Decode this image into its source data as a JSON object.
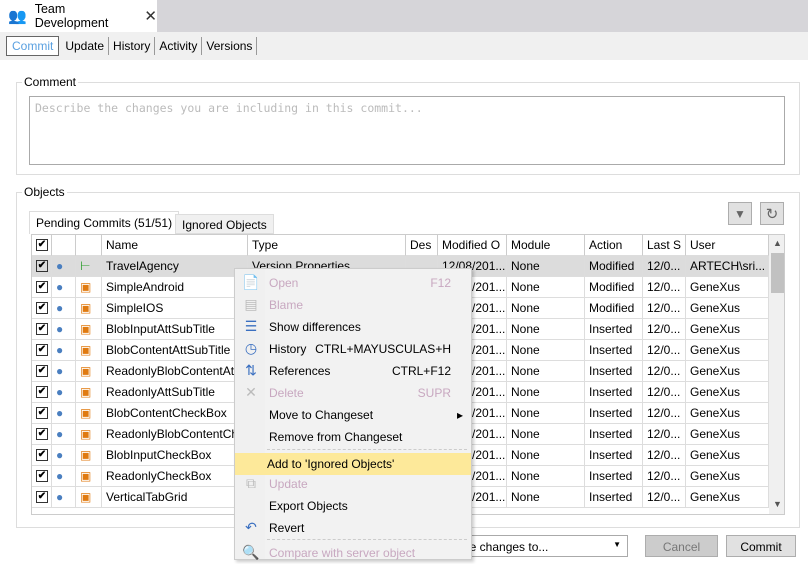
{
  "window": {
    "tab_title": "Team Development",
    "close": "✕"
  },
  "subtabs": [
    "Commit",
    "Update",
    "History",
    "Activity",
    "Versions"
  ],
  "comment": {
    "label": "Comment",
    "placeholder": "Describe the changes you are including in this commit..."
  },
  "objects": {
    "label": "Objects",
    "tabs": [
      "Pending Commits (51/51)",
      "Ignored Objects"
    ],
    "columns": [
      "Name",
      "Type",
      "Des",
      "Modified O",
      "Module",
      "Action",
      "Last S",
      "User"
    ],
    "rows": [
      {
        "name": "TravelAgency",
        "type": "Version Properties",
        "modified": "12/08/201...",
        "module": "None",
        "action": "Modified",
        "last": "12/0...",
        "user": "ARTECH\\sri...",
        "checked": true,
        "selected": true
      },
      {
        "name": "SimpleAndroid",
        "modified": "12/08/201...",
        "module": "None",
        "action": "Modified",
        "last": "12/0...",
        "user": "GeneXus",
        "checked": true
      },
      {
        "name": "SimpleIOS",
        "modified": "12/08/201...",
        "module": "None",
        "action": "Modified",
        "last": "12/0...",
        "user": "GeneXus",
        "checked": true
      },
      {
        "name": "BlobInputAttSubTitle",
        "modified": "12/08/201...",
        "module": "None",
        "action": "Inserted",
        "last": "12/0...",
        "user": "GeneXus",
        "checked": true
      },
      {
        "name": "BlobContentAttSubTitle",
        "modified": "12/08/201...",
        "module": "None",
        "action": "Inserted",
        "last": "12/0...",
        "user": "GeneXus",
        "checked": true
      },
      {
        "name": "ReadonlyBlobContentAtt...",
        "modified": "12/08/201...",
        "module": "None",
        "action": "Inserted",
        "last": "12/0...",
        "user": "GeneXus",
        "checked": true
      },
      {
        "name": "ReadonlyAttSubTitle",
        "modified": "12/08/201...",
        "module": "None",
        "action": "Inserted",
        "last": "12/0...",
        "user": "GeneXus",
        "checked": true
      },
      {
        "name": "BlobContentCheckBox",
        "modified": "12/08/201...",
        "module": "None",
        "action": "Inserted",
        "last": "12/0...",
        "user": "GeneXus",
        "checked": true
      },
      {
        "name": "ReadonlyBlobContentCh...",
        "modified": "12/08/201...",
        "module": "None",
        "action": "Inserted",
        "last": "12/0...",
        "user": "GeneXus",
        "checked": true
      },
      {
        "name": "BlobInputCheckBox",
        "modified": "12/08/201...",
        "module": "None",
        "action": "Inserted",
        "last": "12/0...",
        "user": "GeneXus",
        "checked": true
      },
      {
        "name": "ReadonlyCheckBox",
        "modified": "12/08/201...",
        "module": "None",
        "action": "Inserted",
        "last": "12/0...",
        "user": "GeneXus",
        "checked": true
      },
      {
        "name": "VerticalTabGrid",
        "modified": "12/08/201...",
        "module": "None",
        "action": "Inserted",
        "last": "12/0...",
        "user": "GeneXus",
        "checked": true
      }
    ]
  },
  "context_menu": [
    {
      "label": "Open",
      "shortcut": "F12",
      "disabled": true,
      "icon": "open-icon"
    },
    {
      "label": "Blame",
      "disabled": true,
      "icon": "blame-icon"
    },
    {
      "label": "Show differences",
      "icon": "differences-icon"
    },
    {
      "label": "History",
      "shortcut": "CTRL+MAYUSCULAS+H",
      "icon": "history-icon"
    },
    {
      "label": "References",
      "shortcut": "CTRL+F12",
      "icon": "references-icon"
    },
    {
      "label": "Delete",
      "shortcut": "SUPR",
      "disabled": true,
      "icon": "delete-icon"
    },
    {
      "label": "Move to Changeset",
      "submenu": true
    },
    {
      "label": "Remove from Changeset"
    },
    {
      "label": "Add to 'Ignored Objects'",
      "highlighted": true
    },
    {
      "label": "Update",
      "disabled": true,
      "icon": "update-icon"
    },
    {
      "label": "Export Objects"
    },
    {
      "label": "Revert",
      "icon": "revert-icon"
    },
    {
      "label": "Compare with server object",
      "disabled": true,
      "icon": "compare-icon"
    }
  ],
  "footer": {
    "move_select": "Move changes to...",
    "cancel": "Cancel",
    "commit": "Commit"
  },
  "colors": {
    "accent": "#5aa0e0",
    "highlight": "#fde99a"
  }
}
